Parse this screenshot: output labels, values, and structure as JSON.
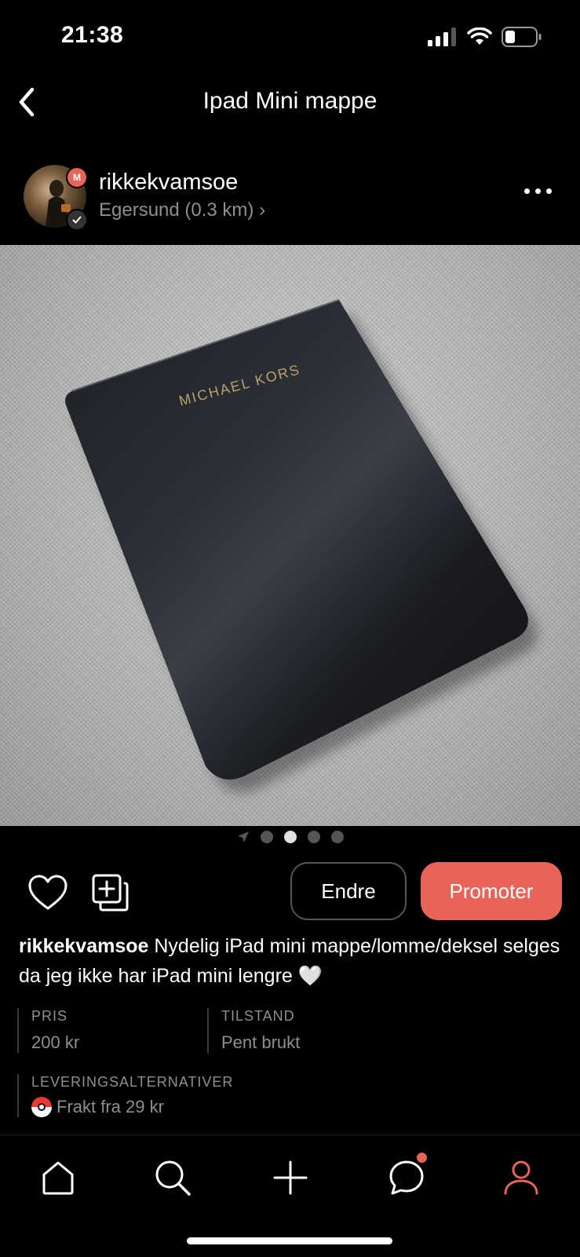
{
  "status_bar": {
    "time": "21:38"
  },
  "nav": {
    "title": "Ipad Mini mappe"
  },
  "seller": {
    "username": "rikkekvamsoe",
    "location": "Egersund (0.3 km) ›",
    "badge_letter": "M"
  },
  "product_image": {
    "brand_text": "MICHAEL KORS",
    "current_image": 2,
    "image_count": 4
  },
  "actions": {
    "edit_label": "Endre",
    "promote_label": "Promoter"
  },
  "description": {
    "username": "rikkekvamsoe",
    "text": "Nydelig iPad mini mappe/lomme/deksel selges da jeg ikke har iPad mini lengre 🤍"
  },
  "details": {
    "price_label": "PRIS",
    "price_value": "200 kr",
    "condition_label": "TILSTAND",
    "condition_value": "Pent brukt",
    "shipping_label": "LEVERINGSALTERNATIVER",
    "shipping_value": "Frakt fra 29 kr"
  },
  "colors": {
    "accent": "#e8645a",
    "background": "#000000",
    "muted": "#8e8e93"
  },
  "tabbar": {
    "items": [
      {
        "name": "home",
        "icon": "home-icon"
      },
      {
        "name": "search",
        "icon": "search-icon"
      },
      {
        "name": "sell",
        "icon": "plus-icon"
      },
      {
        "name": "messages",
        "icon": "chat-icon",
        "has_notification": true
      },
      {
        "name": "profile",
        "icon": "profile-icon",
        "active": true
      }
    ]
  }
}
